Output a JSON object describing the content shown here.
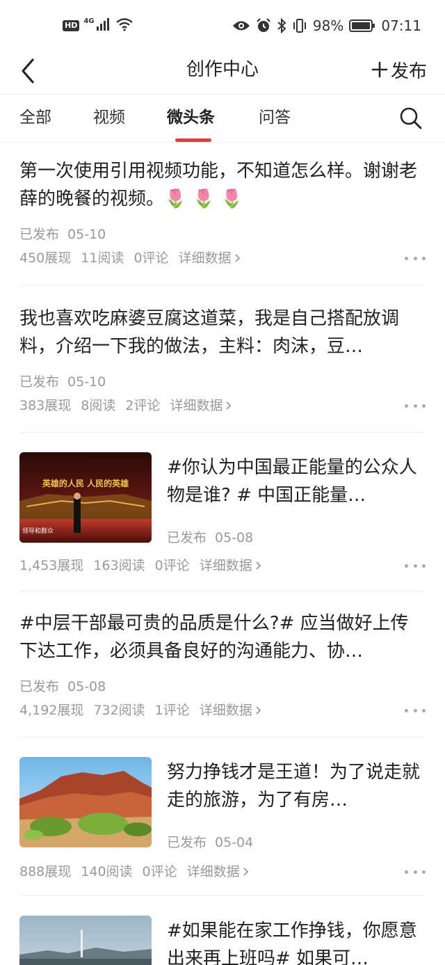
{
  "status_bar": {
    "hd": "HD",
    "network": "4G",
    "battery_percent": "98%",
    "time": "07:11"
  },
  "nav": {
    "title": "创作中心",
    "publish_label": "发布"
  },
  "tabs": [
    {
      "label": "全部"
    },
    {
      "label": "视频"
    },
    {
      "label": "微头条",
      "active": true
    },
    {
      "label": "问答"
    }
  ],
  "posts": [
    {
      "text": "第一次使用引用视频功能，不知道怎么样。谢谢老薛的晚餐的视频。🌷 🌷 🌷",
      "status": "已发布",
      "date": "05-10",
      "impressions": "450展现",
      "reads": "11阅读",
      "comments": "0评论",
      "detail": "详细数据"
    },
    {
      "text": "我也喜欢吃麻婆豆腐这道菜，我是自己搭配放调料，介绍一下我的做法，主料：肉沫，豆…",
      "status": "已发布",
      "date": "05-10",
      "impressions": "383展现",
      "reads": "8阅读",
      "comments": "2评论",
      "detail": "详细数据"
    },
    {
      "text": "#你认为中国最正能量的公众人物是谁? # 中国正能量…",
      "status": "已发布",
      "date": "05-08",
      "impressions": "1,453展现",
      "reads": "163阅读",
      "comments": "0评论",
      "detail": "详细数据",
      "thumb_title": "英雄的人民 人民的英雄",
      "thumb_caption": "领导和群众"
    },
    {
      "text": "#中层干部最可贵的品质是什么?# 应当做好上传下达工作，必须具备良好的沟通能力、协…",
      "status": "已发布",
      "date": "05-08",
      "impressions": "4,192展现",
      "reads": "732阅读",
      "comments": "1评论",
      "detail": "详细数据"
    },
    {
      "text": "努力挣钱才是王道！为了说走就走的旅游，为了有房…",
      "status": "已发布",
      "date": "05-04",
      "impressions": "888展现",
      "reads": "140阅读",
      "comments": "0评论",
      "detail": "详细数据"
    },
    {
      "text": "#如果能在家工作挣钱，你愿意出来再上班吗# 如果可…"
    }
  ],
  "colors": {
    "accent": "#e8393a",
    "meta_text": "#999999",
    "divider": "#eeeeee"
  }
}
